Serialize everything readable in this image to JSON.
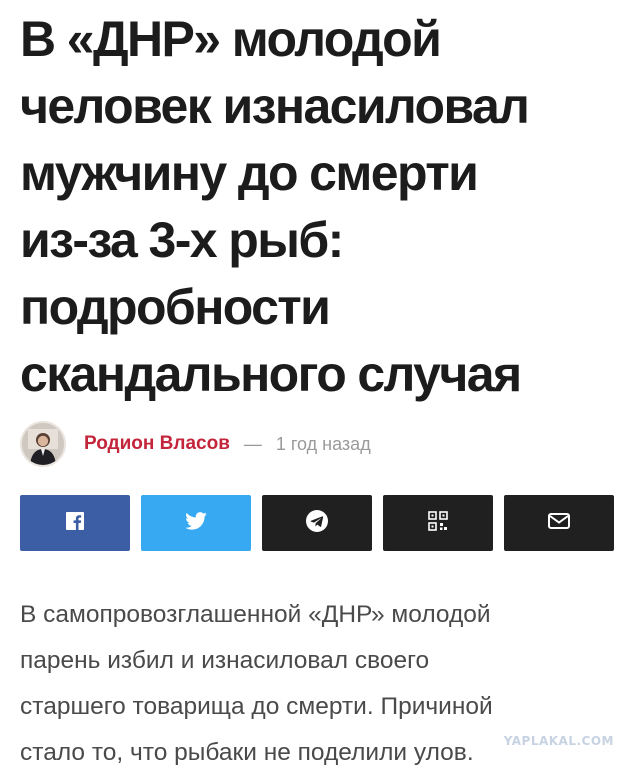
{
  "article": {
    "headline_lines": [
      "В «ДНР» молодой",
      "человек изнасиловал",
      "мужчину до смерти",
      "из-за 3-х рыб:",
      "подробности",
      "скандального случая"
    ],
    "author": "Родион Власов",
    "separator": "—",
    "published": "1 год назад",
    "body_lines": [
      "В самопровозглашенной «ДНР» молодой",
      "парень избил и изнасиловал своего",
      "старшего товарища до смерти. Причиной",
      "стало то, что рыбаки не поделили улов."
    ]
  },
  "share": {
    "buttons": [
      {
        "name": "facebook",
        "icon": "facebook-icon",
        "color": "#3b5ea5"
      },
      {
        "name": "twitter",
        "icon": "twitter-bird-icon",
        "color": "#36a9f2"
      },
      {
        "name": "telegram",
        "icon": "telegram-icon",
        "color": "#202020"
      },
      {
        "name": "qr-code",
        "icon": "qr-code-icon",
        "color": "#202020"
      },
      {
        "name": "email",
        "icon": "envelope-icon",
        "color": "#202020"
      }
    ]
  },
  "watermark": "YAPLAKAL.COM",
  "colors": {
    "headline": "#1c1c1c",
    "author": "#c3253a",
    "meta": "#9a9a9a",
    "body": "#4a4a4a"
  }
}
